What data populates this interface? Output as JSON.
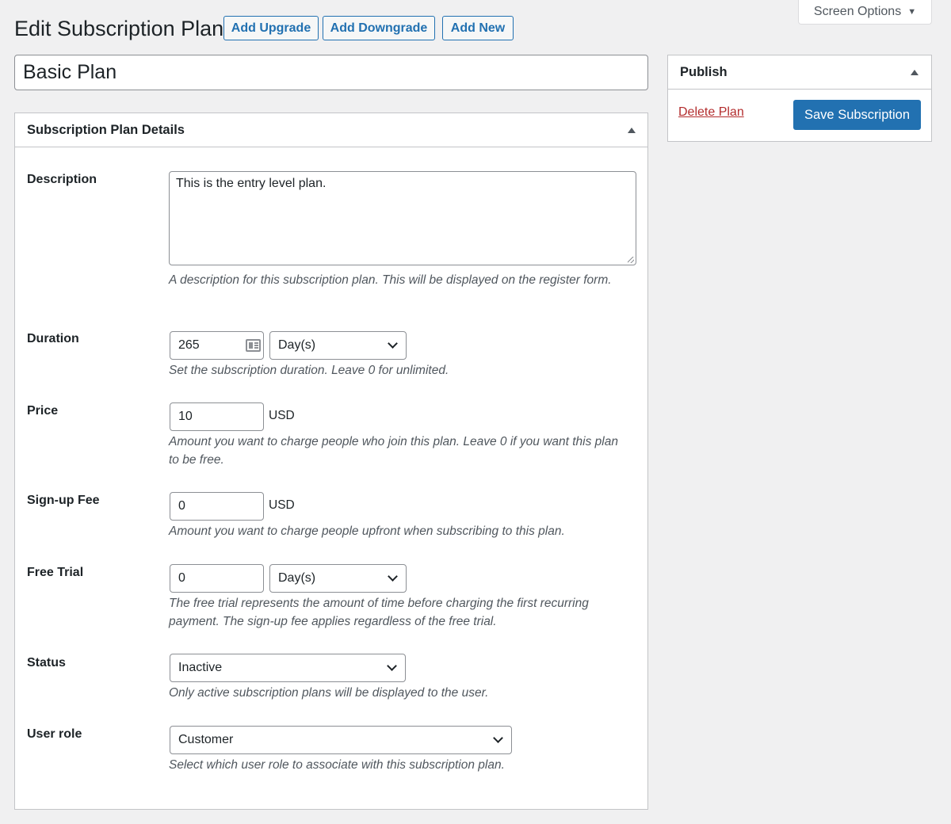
{
  "screen_options": {
    "label": "Screen Options"
  },
  "header": {
    "title": "Edit Subscription Plan",
    "buttons": {
      "upgrade": "Add Upgrade",
      "downgrade": "Add Downgrade",
      "new": "Add New"
    }
  },
  "plan_title": "Basic Plan",
  "details": {
    "heading": "Subscription Plan Details",
    "description": {
      "label": "Description",
      "value": "This is the entry level plan.",
      "help": "A description for this subscription plan. This will be displayed on the register form."
    },
    "duration": {
      "label": "Duration",
      "value": "265",
      "unit": "Day(s)",
      "help": "Set the subscription duration. Leave 0 for unlimited."
    },
    "price": {
      "label": "Price",
      "value": "10",
      "currency": "USD",
      "help": "Amount you want to charge people who join this plan. Leave 0 if you want this plan to be free."
    },
    "signup_fee": {
      "label": "Sign-up Fee",
      "value": "0",
      "currency": "USD",
      "help": "Amount you want to charge people upfront when subscribing to this plan."
    },
    "free_trial": {
      "label": "Free Trial",
      "value": "0",
      "unit": "Day(s)",
      "help": "The free trial represents the amount of time before charging the first recurring payment. The sign-up fee applies regardless of the free trial."
    },
    "status": {
      "label": "Status",
      "value": "Inactive",
      "help": "Only active subscription plans will be displayed to the user."
    },
    "user_role": {
      "label": "User role",
      "value": "Customer",
      "help": "Select which user role to associate with this subscription plan."
    }
  },
  "publish": {
    "heading": "Publish",
    "delete_label": "Delete Plan",
    "save_label": "Save Subscription"
  },
  "colors": {
    "accent": "#2271b1",
    "danger": "#b32d2e",
    "background": "#f0f0f1"
  }
}
